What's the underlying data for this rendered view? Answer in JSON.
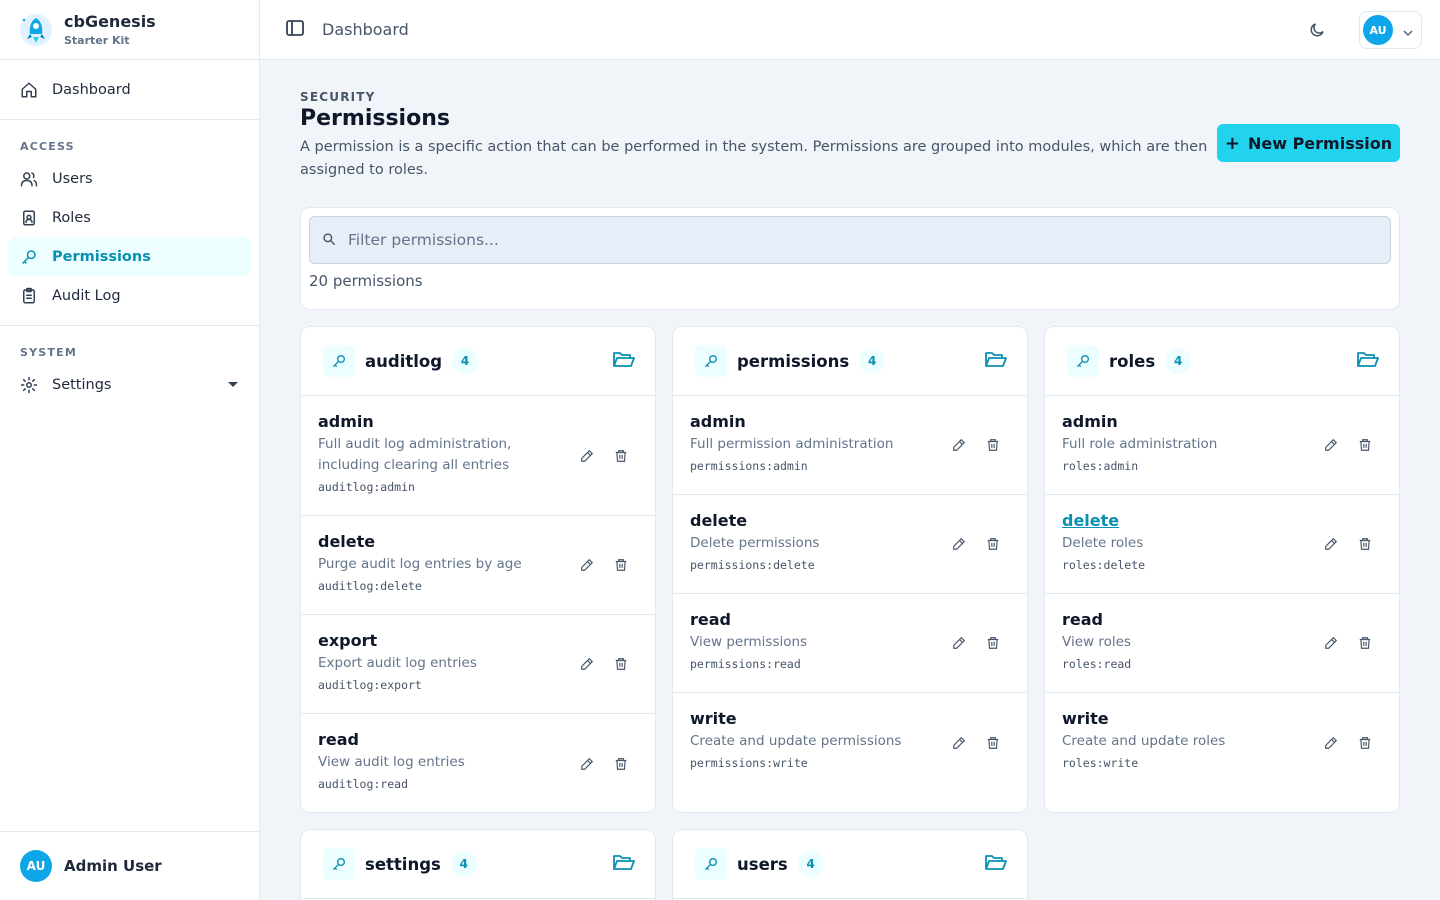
{
  "brand": {
    "name": "cbGenesis",
    "subtitle": "Starter Kit"
  },
  "sidebar": {
    "dashboard": {
      "label": "Dashboard",
      "icon": "home-icon"
    },
    "access": {
      "title": "ACCESS",
      "items": [
        {
          "label": "Users",
          "icon": "users-icon"
        },
        {
          "label": "Roles",
          "icon": "id-badge-icon"
        },
        {
          "label": "Permissions",
          "icon": "key-icon",
          "active": true
        },
        {
          "label": "Audit Log",
          "icon": "clipboard-icon"
        }
      ]
    },
    "system": {
      "title": "SYSTEM",
      "items": [
        {
          "label": "Settings",
          "icon": "gear-icon"
        }
      ]
    },
    "footer": {
      "initials": "AU",
      "name": "Admin User"
    }
  },
  "topbar": {
    "title": "Dashboard",
    "user_initials": "AU"
  },
  "page": {
    "eyebrow": "SECURITY",
    "title": "Permissions",
    "description": "A permission is a specific action that can be performed in the system. Permissions are grouped into modules, which are then assigned to roles.",
    "new_button": "New Permission"
  },
  "filter": {
    "placeholder": "Filter permissions...",
    "count_text": "20 permissions"
  },
  "modules": [
    {
      "name": "auditlog",
      "count": "4",
      "permissions": [
        {
          "name": "admin",
          "description": "Full audit log administration, including clearing all entries",
          "key": "auditlog:admin"
        },
        {
          "name": "delete",
          "description": "Purge audit log entries by age",
          "key": "auditlog:delete"
        },
        {
          "name": "export",
          "description": "Export audit log entries",
          "key": "auditlog:export"
        },
        {
          "name": "read",
          "description": "View audit log entries",
          "key": "auditlog:read"
        }
      ]
    },
    {
      "name": "permissions",
      "count": "4",
      "permissions": [
        {
          "name": "admin",
          "description": "Full permission administration",
          "key": "permissions:admin"
        },
        {
          "name": "delete",
          "description": "Delete permissions",
          "key": "permissions:delete"
        },
        {
          "name": "read",
          "description": "View permissions",
          "key": "permissions:read"
        },
        {
          "name": "write",
          "description": "Create and update permissions",
          "key": "permissions:write"
        }
      ]
    },
    {
      "name": "roles",
      "count": "4",
      "permissions": [
        {
          "name": "admin",
          "description": "Full role administration",
          "key": "roles:admin"
        },
        {
          "name": "delete",
          "description": "Delete roles",
          "key": "roles:delete"
        },
        {
          "name": "read",
          "description": "View roles",
          "key": "roles:read"
        },
        {
          "name": "write",
          "description": "Create and update roles",
          "key": "roles:write"
        }
      ]
    },
    {
      "name": "settings",
      "count": "4"
    },
    {
      "name": "users",
      "count": "4"
    }
  ],
  "colors": {
    "accent": "#22d3ee",
    "accent_text": "#0891b2",
    "avatar": "#0ea5e9"
  }
}
